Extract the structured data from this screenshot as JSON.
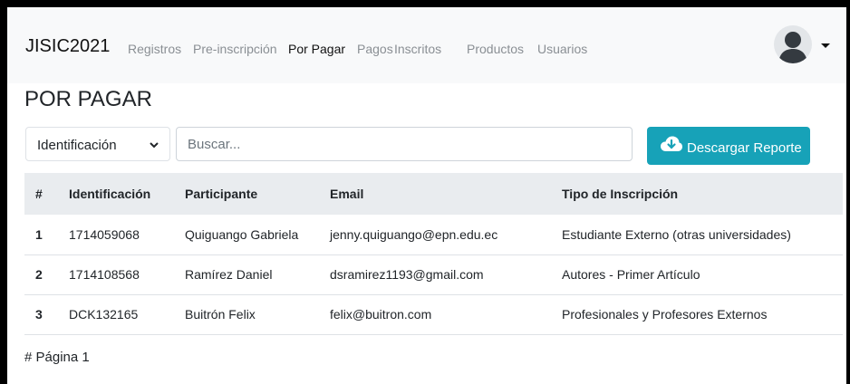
{
  "navbar": {
    "brand": "JISIC2021",
    "links": [
      "Registros",
      "Pre-inscripción",
      "Por Pagar",
      "Pagos",
      "Inscritos",
      "Productos",
      "Usuarios"
    ],
    "active": "Por Pagar"
  },
  "page": {
    "title": "POR PAGAR"
  },
  "filters": {
    "select_value": "Identificación",
    "search_placeholder": "Buscar...",
    "download_label": "Descargar Reporte"
  },
  "table": {
    "headers": [
      "#",
      "Identificación",
      "Participante",
      "Email",
      "Tipo de Inscripción"
    ],
    "rows": [
      [
        "1",
        "1714059068",
        "Quiguango Gabriela",
        "jenny.quiguango@epn.edu.ec",
        "Estudiante Externo (otras universidades)"
      ],
      [
        "2",
        "1714108568",
        "Ramírez Daniel",
        "dsramirez1193@gmail.com",
        "Autores - Primer Artículo"
      ],
      [
        "3",
        "DCK132165",
        "Buitrón Felix",
        "felix@buitron.com",
        "Profesionales y Profesores Externos"
      ]
    ]
  },
  "pagination": {
    "label": "# Página 1"
  },
  "icons": {
    "download": "cloud-download-icon",
    "avatar": "user-avatar-icon",
    "dropdown": "chevron-down-icon"
  },
  "colors": {
    "accent": "#17a2b8",
    "navbar_bg": "#f8f9fa",
    "table_head_bg": "#e9ecef"
  }
}
